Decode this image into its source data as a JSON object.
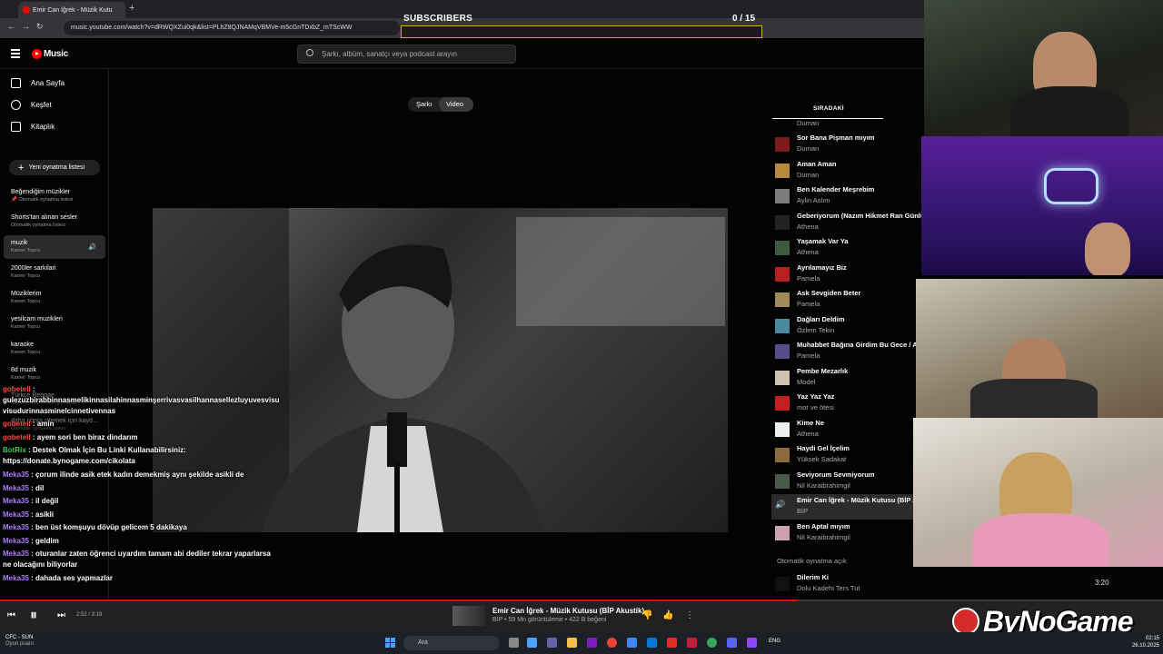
{
  "browser": {
    "tab_title": "Emir Can İğrek - Müzik Kutu",
    "url": "music.youtube.com/watch?v=dRWQXZui0qk&list=PLhZ8QJNAMqVBMVe-m5cGnTDxbZ_mTScWW"
  },
  "overlay": {
    "subscribers_label": "SUBSCRIBERS",
    "subscribers_count": "0 / 15",
    "subscribers_progress": 0,
    "bar_color": "#e0a020"
  },
  "header": {
    "logo": "Music",
    "search_placeholder": "Şarkı, albüm, sanatçı veya podcast arayın"
  },
  "sidebar": {
    "nav": [
      {
        "label": "Ana Sayfa",
        "icon": "home-icon"
      },
      {
        "label": "Keşfet",
        "icon": "compass-icon"
      },
      {
        "label": "Kitaplık",
        "icon": "library-icon"
      }
    ],
    "new_playlist": "Yeni oynatma listesi",
    "playlists": [
      {
        "title": "Beğendiğim müzikler",
        "sub": "📌 Otomatik oynatma listesi"
      },
      {
        "title": "Shorts'tan alınan sesler",
        "sub": "Otomatik oynatma listesi"
      },
      {
        "title": "muzik",
        "sub": "Kamer Topcu"
      },
      {
        "title": "2000ler sarkilari",
        "sub": "Kamer Topcu"
      },
      {
        "title": "Müziklerim",
        "sub": "Kamer Topcu"
      },
      {
        "title": "yesilcam muzikleri",
        "sub": "Kamer Topcu"
      },
      {
        "title": "karaoke",
        "sub": "Kamer Topcu"
      },
      {
        "title": "8d muzik",
        "sub": "Kamer Topcu"
      },
      {
        "title": "Türkçe Reggae",
        "sub": "daha sonra izlemek için kayd..."
      },
      {
        "title": "daha sonra izlemek için kayd...",
        "sub": "Otomatik oynatma listesi"
      }
    ]
  },
  "main": {
    "toggle": {
      "song": "Şarkı",
      "video": "Video"
    }
  },
  "queue": {
    "title": "SIRADAKİ",
    "top_partial": "Duman",
    "items": [
      {
        "title": "Sor Bana Pişman mıyım",
        "artist": "Duman",
        "thumb": "#7a1c1c"
      },
      {
        "title": "Aman Aman",
        "artist": "Duman",
        "thumb": "#b58a3a"
      },
      {
        "title": "Ben Kalender Meşrebim",
        "artist": "Aylin Aslım",
        "thumb": "#7a7a7a"
      },
      {
        "title": "Geberiyorum (Nazım Hikmet Ran Günlü",
        "artist": "Athena",
        "thumb": "#222222"
      },
      {
        "title": "Yaşamak Var Ya",
        "artist": "Athena",
        "thumb": "#3d5a3d"
      },
      {
        "title": "Ayrılamayız Biz",
        "artist": "Pamela",
        "thumb": "#b52020"
      },
      {
        "title": "Ask Sevgiden Beter",
        "artist": "Pamela",
        "thumb": "#a08a5a"
      },
      {
        "title": "Dağları Deldim",
        "artist": "Özlem Tekin",
        "thumb": "#4a8aa0"
      },
      {
        "title": "Muhabbet Bağına Girdim Bu Gece / A",
        "artist": "Pamela",
        "thumb": "#5a4a8a"
      },
      {
        "title": "Pembe Mezarlık",
        "artist": "Model",
        "thumb": "#d0c0b0"
      },
      {
        "title": "Yaz Yaz Yaz",
        "artist": "mor ve ötesi",
        "thumb": "#c02020"
      },
      {
        "title": "Kime Ne",
        "artist": "Athena",
        "thumb": "#eeeeee"
      },
      {
        "title": "Haydi Gel İçelim",
        "artist": "Yüksek Sadakat",
        "thumb": "#8a6a3a"
      },
      {
        "title": "Seviyorum Sevmiyorum",
        "artist": "Nil Karaibrahimgil",
        "thumb": "#4a5a4a"
      },
      {
        "title": "Emir Can İğrek - Müzik Kutusu (BİP A",
        "artist": "BİP",
        "thumb": "#444444"
      },
      {
        "title": "Ben Aptal mıyım",
        "artist": "Nil Karaibrahimgil",
        "thumb": "#d0a0b0"
      }
    ],
    "autoplay_label": "Otomatik oynatma açık",
    "autoplay_item": {
      "title": "Dilerim Ki",
      "artist": "Dolu Kadehi Ters Tut"
    }
  },
  "chat": [
    {
      "user": "gobetell",
      "text": ":",
      "color": "red"
    },
    {
      "user": "",
      "text": "gulezuzbirabbinnasmelikinnasilahinnasminşerrivasvasilhannasellezluyuvesvisu",
      "color": ""
    },
    {
      "user": "",
      "text": "visudurinnasminelcinnetivennas",
      "color": ""
    },
    {
      "user": "gobetell",
      "text": ": amin",
      "color": "red"
    },
    {
      "user": "gobetell",
      "text": ": ayem sori ben biraz dindarım",
      "color": "red"
    },
    {
      "user": "BotRix",
      "text": ": Destek Olmak İçin Bu Linki Kullanabilirsiniz:",
      "color": "green"
    },
    {
      "user": "",
      "text": "https://donate.bynogame.com/cikolata",
      "color": ""
    },
    {
      "user": "Meka35",
      "text": ": çorum ilinde asik etek kadın demekmiş aynı şekilde asikli de",
      "color": "purple"
    },
    {
      "user": "Meka35",
      "text": ": dil",
      "color": "purple"
    },
    {
      "user": "Meka35",
      "text": ": il değil",
      "color": "purple"
    },
    {
      "user": "Meka35",
      "text": ": asikli",
      "color": "purple"
    },
    {
      "user": "Meka35",
      "text": ": ben üst komşuyu dövüp gelicem 5 dakikaya",
      "color": "purple"
    },
    {
      "user": "Meka35",
      "text": ": geldim",
      "color": "purple"
    },
    {
      "user": "Meka35",
      "text": ": oturanlar zaten öğrenci uyardım tamam abi dediler tekrar yaparlarsa",
      "color": "purple"
    },
    {
      "user": "",
      "text": "ne olacağını biliyorlar",
      "color": ""
    },
    {
      "user": "Meka35",
      "text": ": dahada ses yapmazlar",
      "color": "purple"
    }
  ],
  "player": {
    "time": "2:52 / 3:19",
    "progress": 0.862,
    "title": "Emir Can İğrek - Müzik Kutusu (BİP Akustik)",
    "meta": "BİP • 59 Mn görüntüleme • 422 B beğeni",
    "autoplay_duration": "3:20"
  },
  "brand": "ByNoGame",
  "taskbar": {
    "weather_title": "CFC - SUN",
    "weather_sub": "Oyun puanı",
    "search": "Ara",
    "lang": "ENG",
    "time": "02:15",
    "date": "26.10.2025"
  }
}
